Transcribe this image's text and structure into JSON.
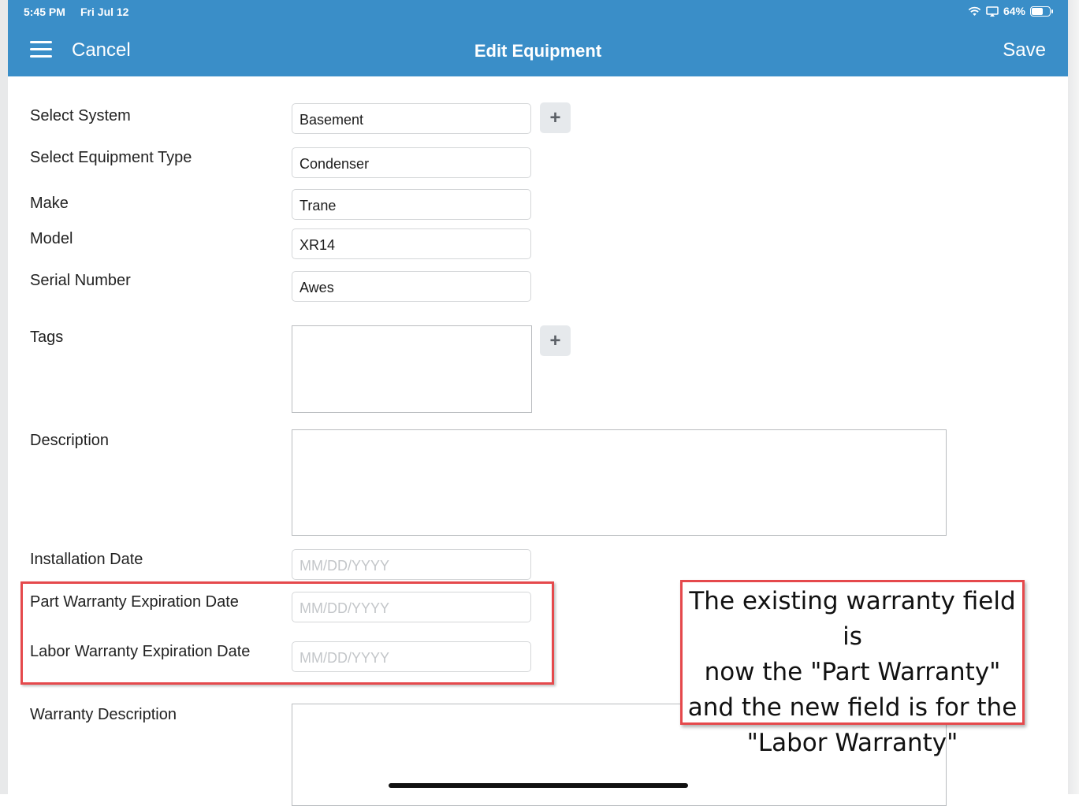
{
  "status_bar": {
    "time": "5:45 PM",
    "date": "Fri Jul 12",
    "battery": "64%"
  },
  "nav": {
    "cancel_label": "Cancel",
    "title": "Edit Equipment",
    "save_label": "Save"
  },
  "form": {
    "select_system": {
      "label": "Select System",
      "value": "Basement"
    },
    "equipment_type": {
      "label": "Select Equipment Type",
      "value": "Condenser"
    },
    "make": {
      "label": "Make",
      "value": "Trane"
    },
    "model": {
      "label": "Model",
      "value": "XR14"
    },
    "serial_number": {
      "label": "Serial Number",
      "value": "Awes"
    },
    "tags": {
      "label": "Tags"
    },
    "description": {
      "label": "Description"
    },
    "installation_date": {
      "label": "Installation Date",
      "placeholder": "MM/DD/YYYY"
    },
    "part_warranty": {
      "label": "Part Warranty Expiration Date",
      "placeholder": "MM/DD/YYYY"
    },
    "labor_warranty": {
      "label": "Labor Warranty Expiration Date",
      "placeholder": "MM/DD/YYYY"
    },
    "warranty_description": {
      "label": "Warranty Description"
    }
  },
  "plus_symbol": "+",
  "annotation": {
    "line1": "The existing warranty field is",
    "line2": "now the \"Part Warranty\"",
    "line3": "and the new field is for the",
    "line4": "\"Labor Warranty\""
  },
  "colors": {
    "nav_blue": "#3a8ec8",
    "highlight_red": "#e5494c"
  },
  "icons": [
    "menu-icon",
    "wifi-icon",
    "screen-mirror-icon",
    "battery-icon",
    "plus-icon"
  ]
}
